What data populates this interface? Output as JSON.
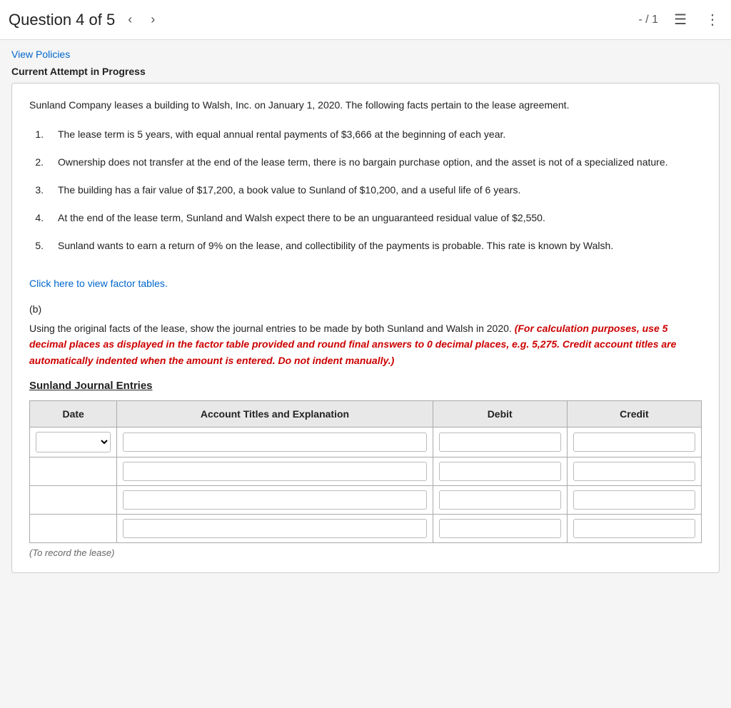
{
  "header": {
    "question_label": "Question 4 of 5",
    "prev_icon": "‹",
    "next_icon": "›",
    "page_indicator": "- / 1",
    "list_icon": "☰",
    "more_icon": "⋮"
  },
  "links": {
    "view_policies": "View Policies",
    "factor_tables": "Click here to view factor tables."
  },
  "attempt": {
    "label": "Current Attempt in Progress"
  },
  "question": {
    "intro": "Sunland Company leases a building to Walsh, Inc. on January 1, 2020. The following facts pertain to the lease agreement.",
    "facts": [
      {
        "num": "1.",
        "text": "The lease term is 5 years, with equal annual rental payments of $3,666 at the beginning of each year."
      },
      {
        "num": "2.",
        "text": "Ownership does not transfer at the end of the lease term, there is no bargain purchase option, and the asset is not of a specialized nature."
      },
      {
        "num": "3.",
        "text": "The building has a fair value of $17,200, a book value to Sunland of $10,200, and a useful life of 6 years."
      },
      {
        "num": "4.",
        "text": "At the end of the lease term, Sunland and Walsh expect there to be an unguaranteed residual value of $2,550."
      },
      {
        "num": "5.",
        "text": "Sunland wants to earn a return of 9% on the lease, and collectibility of the payments is probable. This rate is known by Walsh."
      }
    ]
  },
  "part": {
    "label": "(b)",
    "instruction_prefix": "Using the original facts of the lease, show the journal entries to be made by both Sunland and Walsh in 2020.",
    "instruction_bold": "(For calculation purposes, use 5 decimal places as displayed in the factor table provided and round final answers to 0 decimal places, e.g. 5,275. Credit account titles are automatically indented when the amount is entered. Do not indent manually.)"
  },
  "journal": {
    "title": "Sunland Journal Entries",
    "table": {
      "headers": [
        "Date",
        "Account Titles and Explanation",
        "Debit",
        "Credit"
      ],
      "date_placeholder": "",
      "account_placeholder": "",
      "debit_placeholder": "",
      "credit_placeholder": ""
    },
    "rows": [
      {
        "has_date": true,
        "row_count": 4
      }
    ],
    "bottom_note": "(To record the lease)"
  }
}
